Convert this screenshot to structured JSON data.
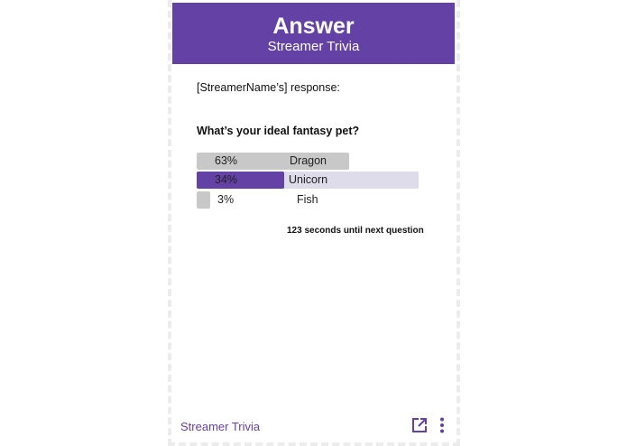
{
  "header": {
    "title": "Answer",
    "subtitle": "Streamer Trivia"
  },
  "response_label": "[StreamerName’s] response:",
  "question": "What’s your ideal fantasy pet?",
  "options": [
    {
      "pct_label": "63%",
      "label": "Dragon",
      "percent": 63,
      "selected": false
    },
    {
      "pct_label": "34%",
      "label": "Unicorn",
      "percent": 34,
      "selected": true
    },
    {
      "pct_label": "3%",
      "label": "Fish",
      "percent": 3,
      "selected": false
    }
  ],
  "timer": "123 seconds until next question",
  "footer": {
    "name": "Streamer Trivia",
    "popout_icon": "popout-icon",
    "more_icon": "more-vertical-icon"
  },
  "colors": {
    "accent": "#6441a5",
    "bar_gray": "#c8c8c8",
    "selected_track": "#dedbeb"
  }
}
